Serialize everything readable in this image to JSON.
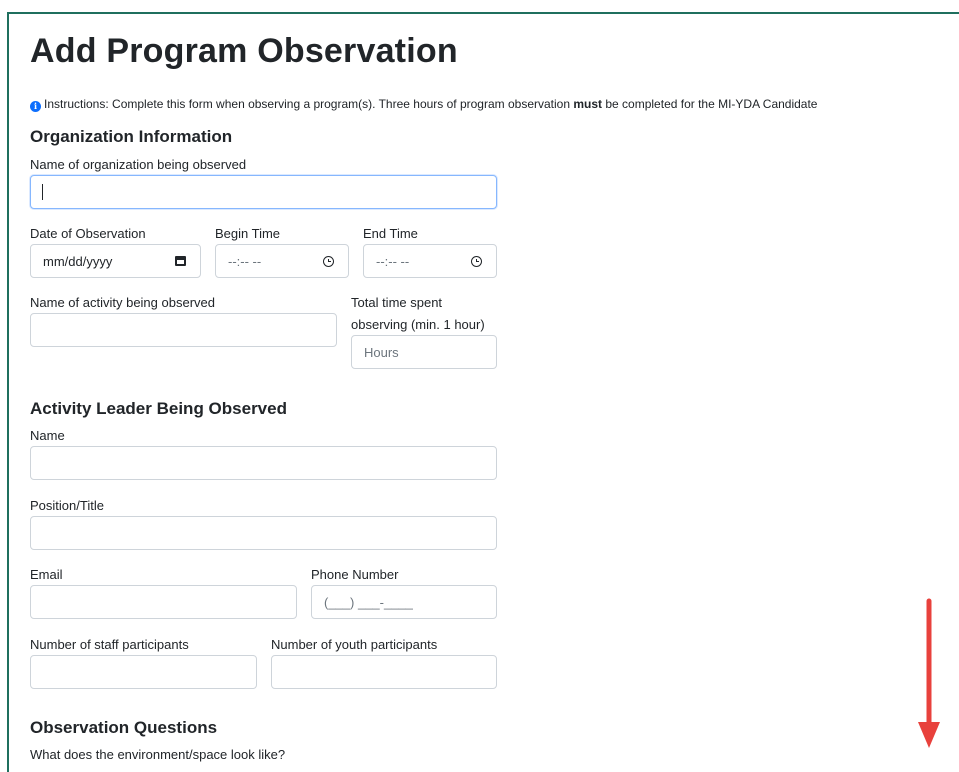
{
  "page": {
    "title": "Add Program Observation",
    "instructions_prefix": "Instructions: Complete this form when observing a program(s). Three hours of program observation ",
    "instructions_bold": "must",
    "instructions_suffix": " be completed for the MI-YDA Candidate"
  },
  "sections": {
    "organization": "Organization Information",
    "leader": "Activity Leader Being Observed",
    "questions": "Observation Questions"
  },
  "fields": {
    "org_name": {
      "label": "Name of organization being observed",
      "value": ""
    },
    "date": {
      "label": "Date of Observation",
      "placeholder": "mm/dd/yyyy"
    },
    "begin_time": {
      "label": "Begin Time",
      "placeholder": "--:-- --"
    },
    "end_time": {
      "label": "End Time",
      "placeholder": "--:-- --"
    },
    "activity_name": {
      "label": "Name of activity being observed",
      "value": ""
    },
    "total_time": {
      "label_line1": "Total time spent",
      "label_line2": "observing (min. 1 hour)",
      "placeholder": "Hours"
    },
    "leader_name": {
      "label": "Name",
      "value": ""
    },
    "position": {
      "label": "Position/Title",
      "value": ""
    },
    "email": {
      "label": "Email",
      "value": ""
    },
    "phone": {
      "label": "Phone Number",
      "placeholder": "(___) ___-____"
    },
    "staff_count": {
      "label": "Number of staff participants",
      "value": ""
    },
    "youth_count": {
      "label": "Number of youth participants",
      "value": ""
    },
    "q1": {
      "label": "What does the environment/space look like?"
    }
  },
  "icons": {
    "info": "info-icon",
    "date": "calendar-icon",
    "time": "clock-icon",
    "annotation": "scroll-down-arrow-icon"
  },
  "colors": {
    "frame": "#1f6f5e",
    "info": "#0d6efd",
    "arrow": "#e8413c"
  }
}
